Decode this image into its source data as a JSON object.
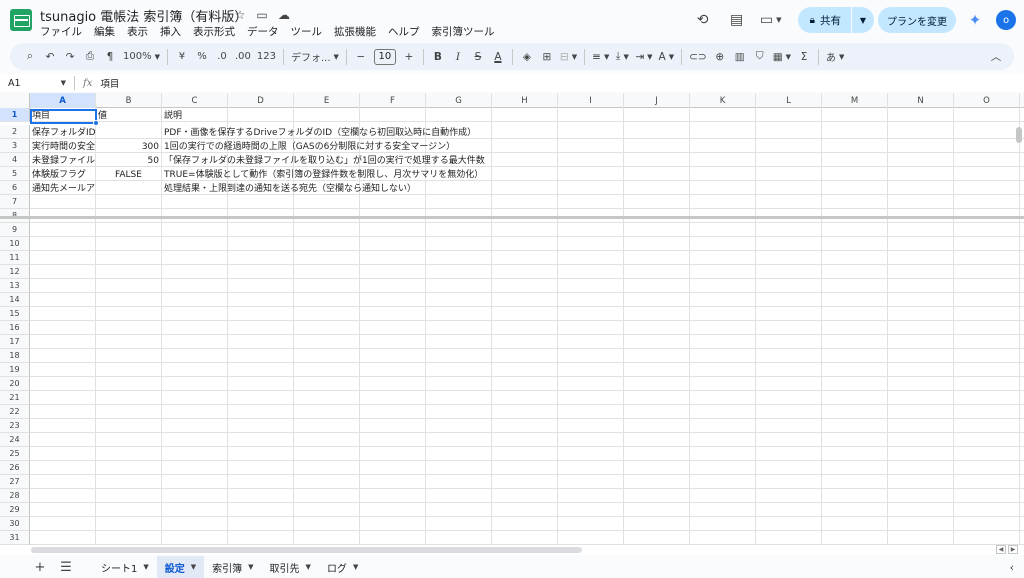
{
  "title": "tsunagio 電帳法 索引簿（有料版）",
  "menu": [
    "ファイル",
    "編集",
    "表示",
    "挿入",
    "表示形式",
    "データ",
    "ツール",
    "拡張機能",
    "ヘルプ",
    "索引簿ツール"
  ],
  "share_label": "共有",
  "plan_label": "プランを変更",
  "avatar_letter": "o",
  "toolbar": {
    "zoom": "100%",
    "currency": "¥",
    "percent": "%",
    "dec_decrease": ".0",
    "dec_increase": ".00",
    "number_format": "123",
    "font": "デフォ...",
    "font_size": "10",
    "ime": "あ"
  },
  "formula_bar": {
    "name_box": "A1",
    "fx": "fx",
    "value": "項目"
  },
  "columns": [
    "A",
    "B",
    "C",
    "D",
    "E",
    "F",
    "G",
    "H",
    "I",
    "J",
    "K",
    "L",
    "M",
    "N",
    "O"
  ],
  "rows": [
    [
      "項目",
      "値",
      "説明"
    ],
    [
      "保存フォルダID",
      "",
      "PDF・画像を保存するDriveフォルダのID（空欄なら初回取込時に自動作成）"
    ],
    [
      "実行時間の安全",
      "300",
      "1回の実行での経過時間の上限（GASの6分制限に対する安全マージン）"
    ],
    [
      "未登録ファイル",
      "50",
      "「保存フォルダの未登録ファイルを取り込む」が1回の実行で処理する最大件数"
    ],
    [
      "体験版フラグ",
      "FALSE",
      "TRUE=体験版として動作（索引簿の登録件数を制限し、月次サマリを無効化）"
    ],
    [
      "通知先メールアドレス",
      "",
      "処理結果・上限到達の通知を送る宛先（空欄なら通知しない）"
    ]
  ],
  "sheet_tabs": [
    "シート1",
    "設定",
    "索引簿",
    "取引先",
    "ログ"
  ],
  "active_tab": "設定"
}
